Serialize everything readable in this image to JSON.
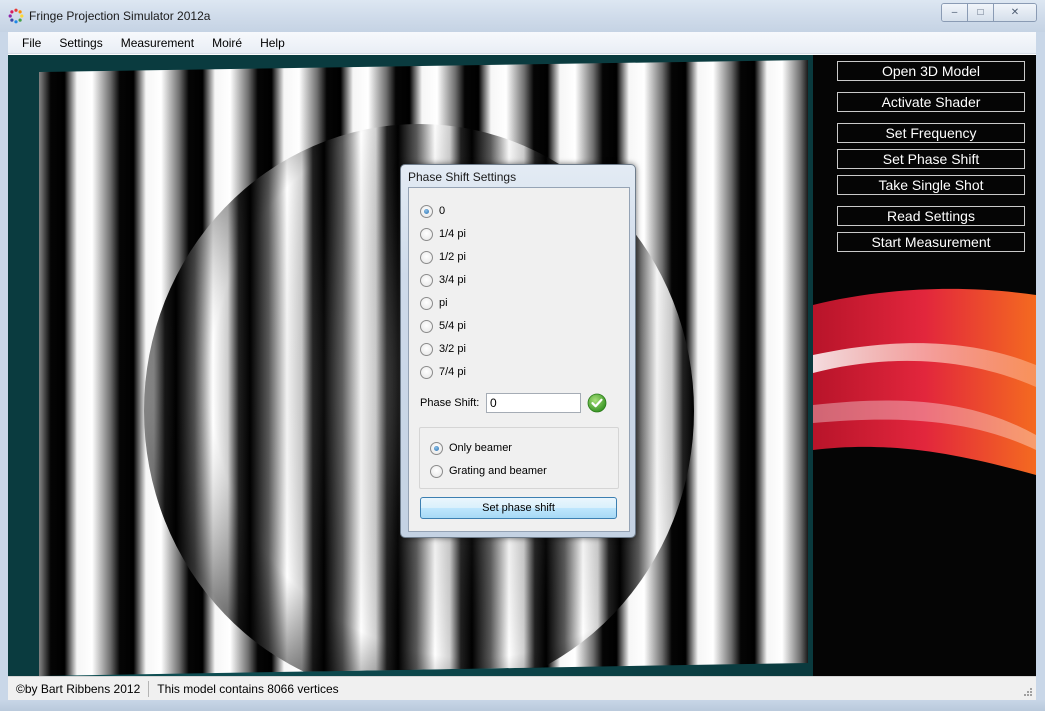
{
  "window": {
    "title": "Fringe Projection Simulator 2012a",
    "controls": {
      "minimize": "–",
      "maximize": "□",
      "close": "✕"
    }
  },
  "menu": [
    "File",
    "Settings",
    "Measurement",
    "Moiré",
    "Help"
  ],
  "side_buttons": [
    "Open 3D Model",
    "Activate Shader",
    "Set Frequency",
    "Set Phase Shift",
    "Take Single Shot",
    "Read Settings",
    "Start Measurement"
  ],
  "dialog": {
    "title": "Phase Shift Settings",
    "phase_options": [
      "0",
      "1/4 pi",
      "1/2 pi",
      "3/4 pi",
      "pi",
      "5/4 pi",
      "3/2 pi",
      "7/4 pi"
    ],
    "selected_phase_index": 0,
    "phase_label": "Phase Shift:",
    "phase_value": "0",
    "mode_options": [
      "Only beamer",
      "Grating and beamer"
    ],
    "selected_mode_index": 0,
    "set_button": "Set phase shift"
  },
  "status": {
    "copyright": "©by Bart Ribbens 2012",
    "info": "This model contains 8066 vertices"
  },
  "icons": {
    "app": "app-logo-icon",
    "ok": "checkmark-icon",
    "grip": "resize-grip-icon"
  },
  "colors": {
    "side_bg": "#060606",
    "swoosh_red": "#d8283a",
    "swoosh_orange": "#f05a1e",
    "accent_blue": "#3c7fb1",
    "teal_bg": "#0d4a4f"
  }
}
